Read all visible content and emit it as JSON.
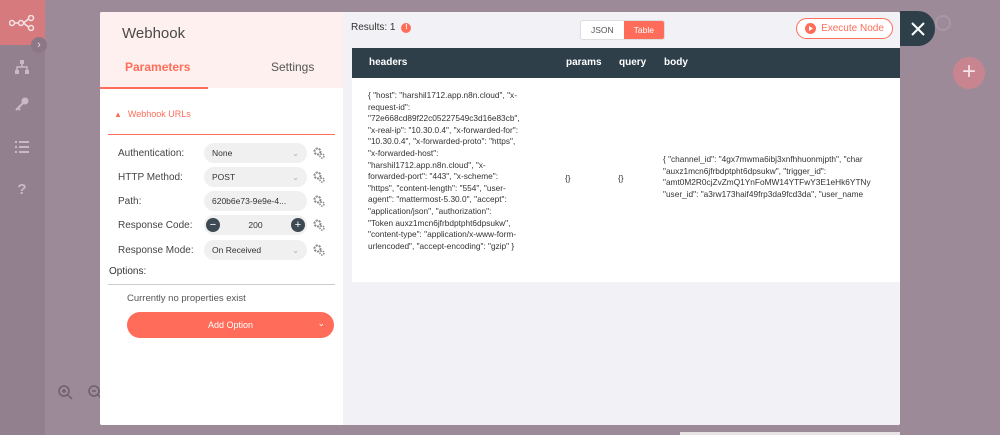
{
  "modal": {
    "title": "Webhook",
    "tabs": {
      "parameters": "Parameters",
      "settings": "Settings"
    },
    "section": "Webhook URLs",
    "fields": {
      "authentication": {
        "label": "Authentication:",
        "value": "None"
      },
      "http_method": {
        "label": "HTTP Method:",
        "value": "POST"
      },
      "path": {
        "label": "Path:",
        "value": "620b6e73-9e9e-4..."
      },
      "response_code": {
        "label": "Response Code:",
        "value": "200"
      },
      "response_mode": {
        "label": "Response Mode:",
        "value": "On Received"
      }
    },
    "options": {
      "label": "Options:",
      "empty_text": "Currently no properties exist",
      "add_button": "Add Option"
    }
  },
  "output": {
    "results_label": "Results: 1",
    "view": {
      "json": "JSON",
      "table": "Table",
      "active": "Table"
    },
    "execute_button": "Execute Node",
    "table": {
      "columns": [
        "headers",
        "params",
        "query",
        "body"
      ],
      "headers_lines": [
        "{ \"host\": \"harshil1712.app.n8n.cloud\", \"x-",
        "request-id\":",
        "\"72e668cd89f22c05227549c3d16e83cb\",",
        "\"x-real-ip\": \"10.30.0.4\", \"x-forwarded-for\":",
        "\"10.30.0.4\", \"x-forwarded-proto\": \"https\",",
        "\"x-forwarded-host\":",
        "\"harshil1712.app.n8n.cloud\", \"x-",
        "forwarded-port\": \"443\", \"x-scheme\":",
        "\"https\", \"content-length\": \"554\", \"user-",
        "agent\": \"mattermost-5.30.0\", \"accept\":",
        "\"application/json\", \"authorization\":",
        "\"Token auxz1mcn6jfrbdptpht6dpsukw\",",
        "\"content-type\": \"application/x-www-form-",
        "urlencoded\", \"accept-encoding\": \"gzip\" }"
      ],
      "params": "{}",
      "query": "{}",
      "body_lines": [
        "{ \"channel_id\": \"4gx7mwma6ibj3xnfhhuonmjpth\", \"char",
        "\"auxz1mcn6jfrbdptpht6dpsukw\", \"trigger_id\":",
        "\"amt0M2R0cjZvZmQ1YnFoMW14YTFwY3E1eHk6YTNy",
        "\"user_id\": \"a3rw173haif49frp3da9fcd3da\", \"user_name"
      ]
    }
  },
  "icons": {
    "close": "close-icon",
    "gear": "gear-icon",
    "play": "play-icon",
    "info": "info-icon",
    "chevron": "chevron-down-icon"
  },
  "colors": {
    "accent": "#ff6d5a",
    "dark": "#2e3f4a",
    "panel": "#f2f1f5"
  }
}
